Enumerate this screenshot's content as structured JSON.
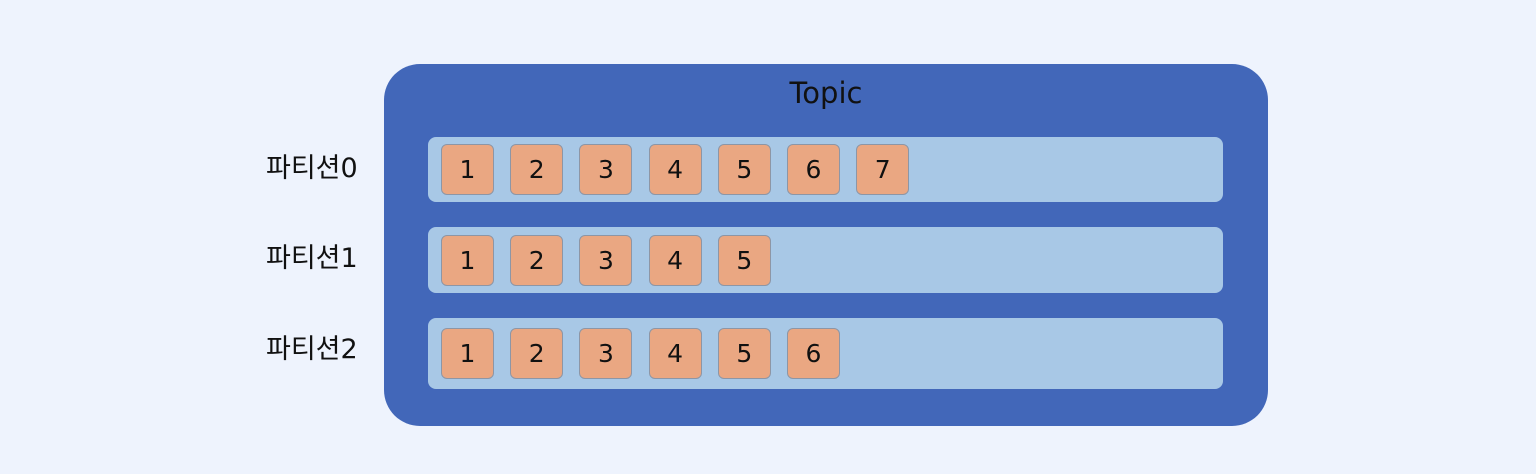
{
  "topic": {
    "title": "Topic"
  },
  "partitions": [
    {
      "label": "파티션0",
      "messages": [
        "1",
        "2",
        "3",
        "4",
        "5",
        "6",
        "7"
      ]
    },
    {
      "label": "파티션1",
      "messages": [
        "1",
        "2",
        "3",
        "4",
        "5"
      ]
    },
    {
      "label": "파티션2",
      "messages": [
        "1",
        "2",
        "3",
        "4",
        "5",
        "6"
      ]
    }
  ],
  "colors": {
    "background": "#eef3fd",
    "topic_fill": "#4267b9",
    "partition_fill": "#a8c8e6",
    "message_fill": "#eaa782"
  }
}
